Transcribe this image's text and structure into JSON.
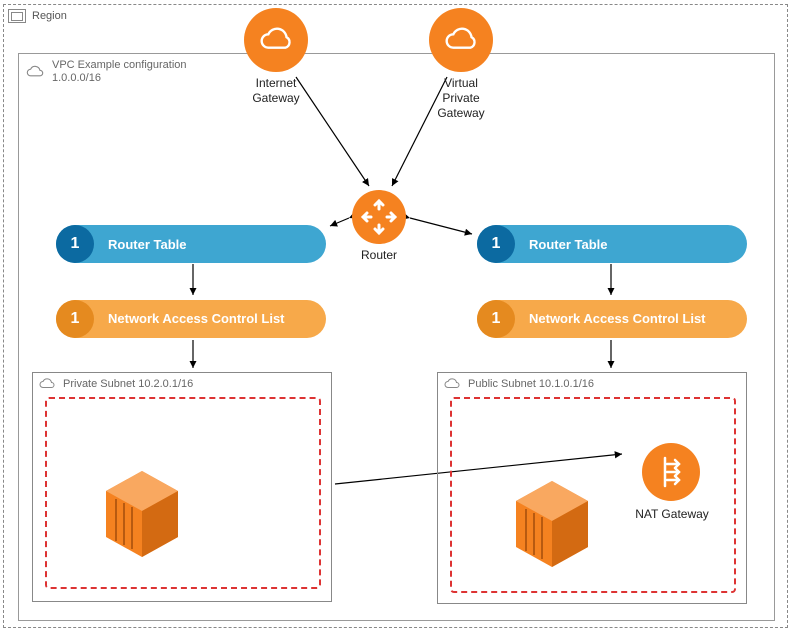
{
  "region": {
    "label": "Region"
  },
  "vpc": {
    "label_line1": "VPC Example configuration",
    "label_line2": "1.0.0.0/16"
  },
  "gateways": {
    "internet": {
      "label": "Internet\nGateway"
    },
    "virtual_private": {
      "label": "Virtual\nPrivate\nGateway"
    }
  },
  "router": {
    "label": "Router"
  },
  "left": {
    "route_table": {
      "num": "1",
      "label": "Router Table"
    },
    "nacl": {
      "num": "1",
      "label": "Network Access Control List"
    },
    "subnet": {
      "label": "Private Subnet 10.2.0.1/16"
    }
  },
  "right": {
    "route_table": {
      "num": "1",
      "label": "Router Table"
    },
    "nacl": {
      "num": "1",
      "label": "Network Access Control List"
    },
    "subnet": {
      "label": "Public Subnet 10.1.0.1/16"
    },
    "nat": {
      "label": "NAT Gateway"
    }
  }
}
